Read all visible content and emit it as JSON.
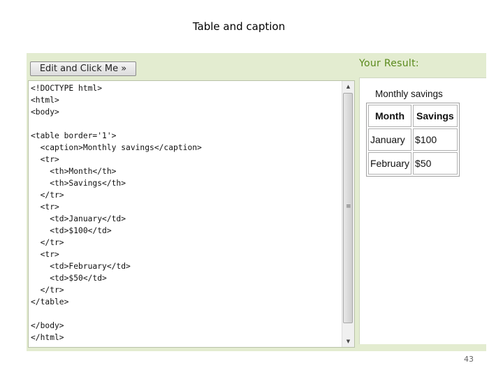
{
  "slide": {
    "title": "Table and caption",
    "page_number": "43"
  },
  "editor": {
    "run_button_label": "Edit and Click Me »",
    "code": "<!DOCTYPE html>\n<html>\n<body>\n\n<table border='1'>\n  <caption>Monthly savings</caption>\n  <tr>\n    <th>Month</th>\n    <th>Savings</th>\n  </tr>\n  <tr>\n    <td>January</td>\n    <td>$100</td>\n  </tr>\n  <tr>\n    <td>February</td>\n    <td>$50</td>\n  </tr>\n</table>\n\n</body>\n</html>",
    "scroll_up_icon": "▲",
    "scroll_down_icon": "▼",
    "grip_icon": "≡"
  },
  "result": {
    "label": "Your Result:",
    "table": {
      "caption": "Monthly savings",
      "headers": [
        "Month",
        "Savings"
      ],
      "rows": [
        [
          "January",
          "$100"
        ],
        [
          "February",
          "$50"
        ]
      ]
    }
  },
  "colors": {
    "panel_bg": "#e3ecd0",
    "result_label": "#5a8a1c"
  }
}
